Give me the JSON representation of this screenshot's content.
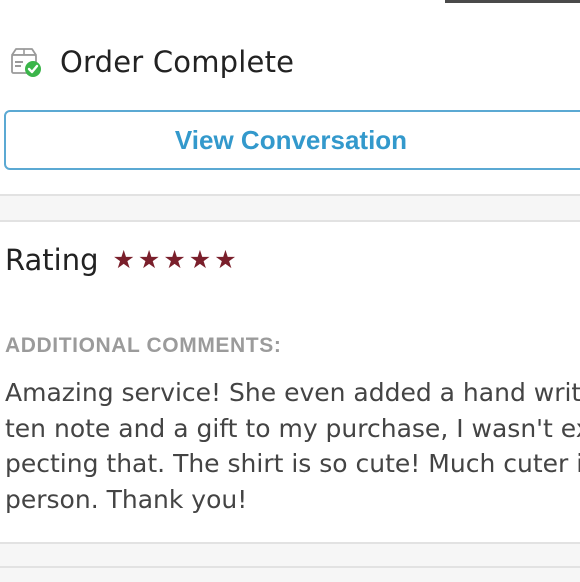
{
  "order": {
    "status_title": "Order Complete",
    "icon": "package-check-icon",
    "check_color": "#3bb54a"
  },
  "actions": {
    "view_conversation_label": "View Conversation",
    "accent_color": "#3399cc"
  },
  "review": {
    "rating_label": "Rating",
    "rating_value": 5,
    "rating_max": 5,
    "star_icon": "star-icon",
    "star_color": "#7a1f2b",
    "comments_heading": "ADDITIONAL COMMENTS:",
    "comment_lines": [
      "Amazing service! She even added a hand writ-",
      "ten note and a gift to my purchase, I wasn't ex-",
      "pecting that. The shirt is so cute! Much cuter in",
      "person. Thank you!"
    ]
  }
}
